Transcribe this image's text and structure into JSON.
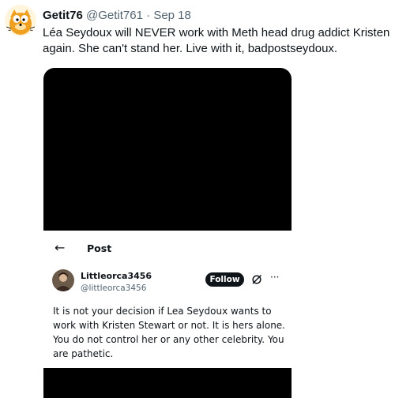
{
  "tweet": {
    "author_name": "Getit76",
    "handle": "@Getit761",
    "separator": " · ",
    "date": "Sep 18",
    "text": "Léa Seydoux will NEVER work with Meth head drug addict Kristen again. She can't stand her. Live with it, badpostseydoux.",
    "avatar_icon": "cartoon-cat-avatar"
  },
  "embedded": {
    "back_icon": "←",
    "title": "Post",
    "author_name": "Littleorca3456",
    "handle": "@littleorca3456",
    "follow_label": "Follow",
    "more_icon": "···",
    "text": "It is not your decision if Lea Seydoux wants to work with Kristen Stewart or not. It is hers alone. You do not control her or any other celebrity. You are pathetic."
  },
  "colors": {
    "text": "#0f1419",
    "secondary": "#536471",
    "media_bg": "#000000"
  }
}
